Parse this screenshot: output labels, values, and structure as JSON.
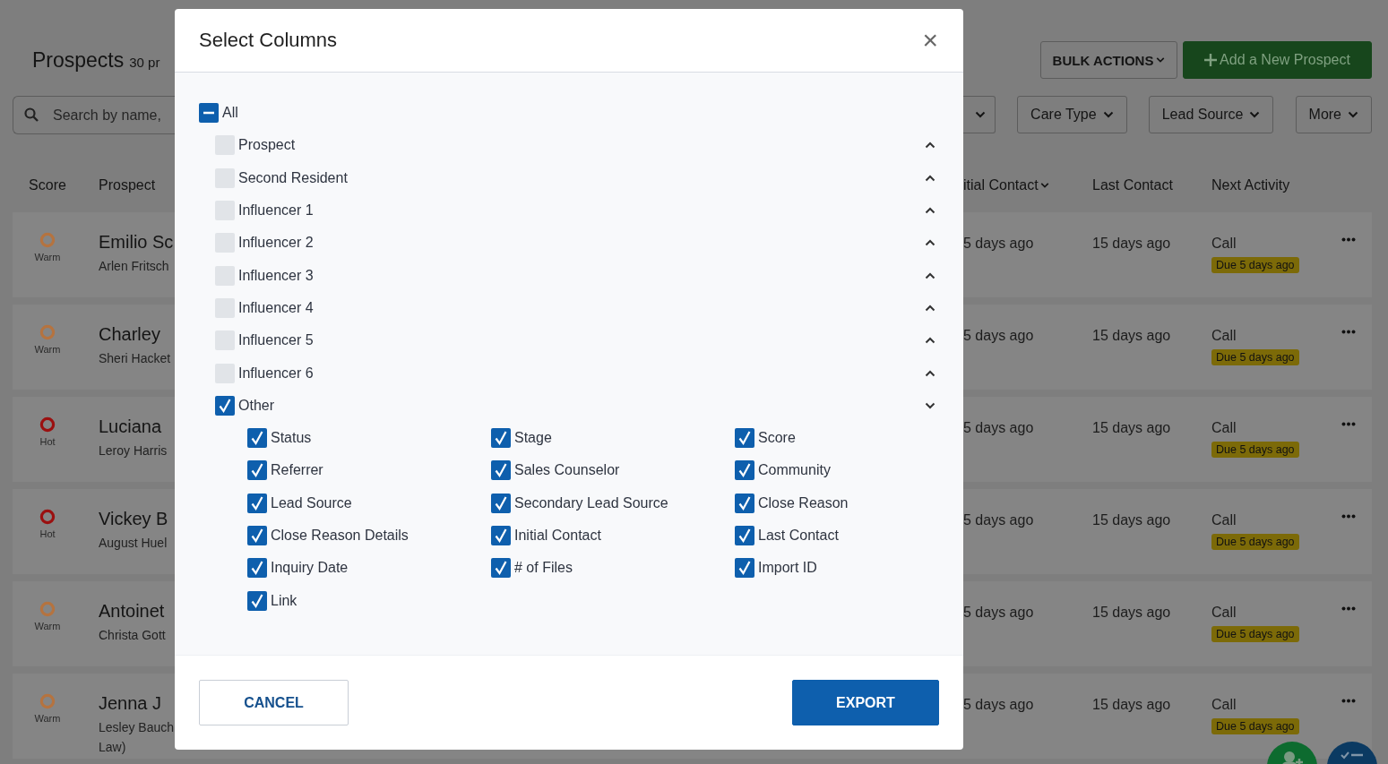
{
  "page": {
    "title": "Prospects",
    "count": "30 pr"
  },
  "search": {
    "placeholder": "Search by name,"
  },
  "toolbar": [
    {
      "label": "BULK ACTIONS",
      "kind": "menu"
    },
    {
      "label": "Add a New Prospect",
      "kind": "primary"
    }
  ],
  "filters": [
    {
      "label": "Care Type"
    },
    {
      "label": "Lead Source"
    },
    {
      "label": "More"
    }
  ],
  "table": {
    "columns_left": [
      "Score",
      "Prospect"
    ],
    "columns_right": [
      "itial Contact",
      "Last Contact",
      "Next Activity"
    ],
    "rows": [
      {
        "score": "Warm",
        "color": "#b5733f",
        "name": "Emilio Sc",
        "contact": [
          "Arlen Fritsch"
        ],
        "initial": "5 days ago",
        "last": "15 days ago",
        "activity": "Call",
        "due": "Due 5 days ago"
      },
      {
        "score": "Warm",
        "color": "#b5733f",
        "name": "Charley",
        "contact": [
          "Sheri Hacket"
        ],
        "initial": "5 days ago",
        "last": "15 days ago",
        "activity": "Call",
        "due": "Due 5 days ago"
      },
      {
        "score": "Hot",
        "color": "#9b1010",
        "name": "Luciana",
        "contact": [
          "Leroy Harris"
        ],
        "initial": "5 days ago",
        "last": "15 days ago",
        "activity": "Call",
        "due": "Due 5 days ago"
      },
      {
        "score": "Hot",
        "color": "#9b1010",
        "name": "Vickey B",
        "contact": [
          "August Huel"
        ],
        "initial": "5 days ago",
        "last": "15 days ago",
        "activity": "Call",
        "due": "Due 5 days ago"
      },
      {
        "score": "Warm",
        "color": "#b5733f",
        "name": "Antoinet",
        "contact": [
          "Christa Gott"
        ],
        "initial": "5 days ago",
        "last": "15 days ago",
        "activity": "Call",
        "due": "Due 5 days ago"
      },
      {
        "score": "Warm",
        "color": "#b5733f",
        "name": "Jenna J",
        "contact": [
          "Lesley Bauch",
          "Law)"
        ],
        "initial": "5 days ago",
        "last": "15 days ago",
        "activity": "Call",
        "due": "Due 5 days ago"
      }
    ]
  },
  "modal": {
    "title": "Select Columns",
    "close": "×",
    "all": {
      "label": "All",
      "indeterminate": true
    },
    "groups": [
      {
        "label": "Prospect",
        "checked": false,
        "expanded": false
      },
      {
        "label": "Second Resident",
        "checked": false,
        "expanded": false
      },
      {
        "label": "Influencer 1",
        "checked": false,
        "expanded": false
      },
      {
        "label": "Influencer 2",
        "checked": false,
        "expanded": false
      },
      {
        "label": "Influencer 3",
        "checked": false,
        "expanded": false
      },
      {
        "label": "Influencer 4",
        "checked": false,
        "expanded": false
      },
      {
        "label": "Influencer 5",
        "checked": false,
        "expanded": false
      },
      {
        "label": "Influencer 6",
        "checked": false,
        "expanded": false
      },
      {
        "label": "Other",
        "checked": true,
        "expanded": true,
        "children": [
          {
            "label": "Status",
            "checked": true
          },
          {
            "label": "Stage",
            "checked": true
          },
          {
            "label": "Score",
            "checked": true
          },
          {
            "label": "Referrer",
            "checked": true
          },
          {
            "label": "Sales Counselor",
            "checked": true
          },
          {
            "label": "Community",
            "checked": true
          },
          {
            "label": "Lead Source",
            "checked": true
          },
          {
            "label": "Secondary Lead Source",
            "checked": true
          },
          {
            "label": "Close Reason",
            "checked": true
          },
          {
            "label": "Close Reason Details",
            "checked": true
          },
          {
            "label": "Initial Contact",
            "checked": true
          },
          {
            "label": "Last Contact",
            "checked": true
          },
          {
            "label": "Inquiry Date",
            "checked": true
          },
          {
            "label": "# of Files",
            "checked": true
          },
          {
            "label": "Import ID",
            "checked": true
          },
          {
            "label": "Link",
            "checked": true
          }
        ]
      }
    ]
  },
  "buttons": [
    {
      "label": "CANCEL",
      "kind": "secondary"
    },
    {
      "label": "EXPORT",
      "kind": "primary"
    }
  ]
}
